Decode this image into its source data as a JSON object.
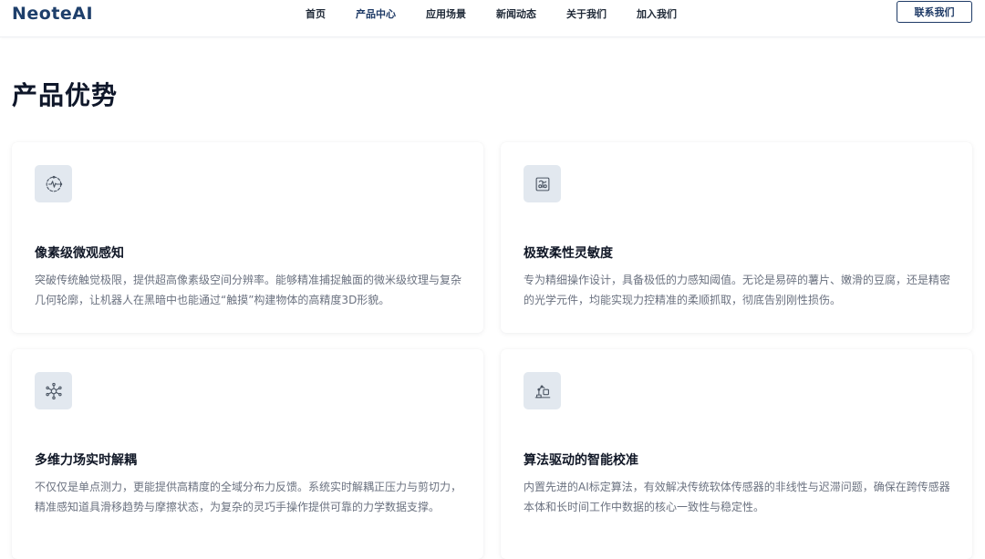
{
  "header": {
    "logo": "NeoteAI",
    "nav": [
      {
        "label": "首页"
      },
      {
        "label": "产品中心"
      },
      {
        "label": "应用场景"
      },
      {
        "label": "新闻动态"
      },
      {
        "label": "关于我们"
      },
      {
        "label": "加入我们"
      }
    ],
    "active_index": 1,
    "contact_label": "联系我们"
  },
  "section": {
    "title": "产品优势"
  },
  "features": [
    {
      "icon": "pulse-sensor-icon",
      "title": "像素级微观感知",
      "desc": "突破传统触觉极限，提供超高像素级空间分辨率。能够精准捕捉触面的微米级纹理与复杂几何轮廓，让机器人在黑暗中也能通过“触摸”构建物体的高精度3D形貌。"
    },
    {
      "icon": "flexible-grip-icon",
      "title": "极致柔性灵敏度",
      "desc": "专为精细操作设计，具备极低的力感知阈值。无论是易碎的薯片、嫩滑的豆腐，还是精密的光学元件，均能实现力控精准的柔顺抓取，彻底告别刚性损伤。"
    },
    {
      "icon": "network-nodes-icon",
      "title": "多维力场实时解耦",
      "desc": "不仅仅是单点测力，更能提供高精度的全域分布力反馈。系统实时解耦正压力与剪切力，精准感知道具滑移趋势与摩擦状态，为复杂的灵巧手操作提供可靠的力学数据支撑。"
    },
    {
      "icon": "robot-arm-icon",
      "title": "算法驱动的智能校准",
      "desc": "内置先进的AI标定算法，有效解决传统软体传感器的非线性与迟滞问题，确保在跨传感器本体和长时间工作中数据的核心一致性与稳定性。"
    }
  ],
  "colors": {
    "brand": "#1e3a66",
    "icon_bg": "#e2e8ef",
    "text_muted": "#6b7280"
  }
}
